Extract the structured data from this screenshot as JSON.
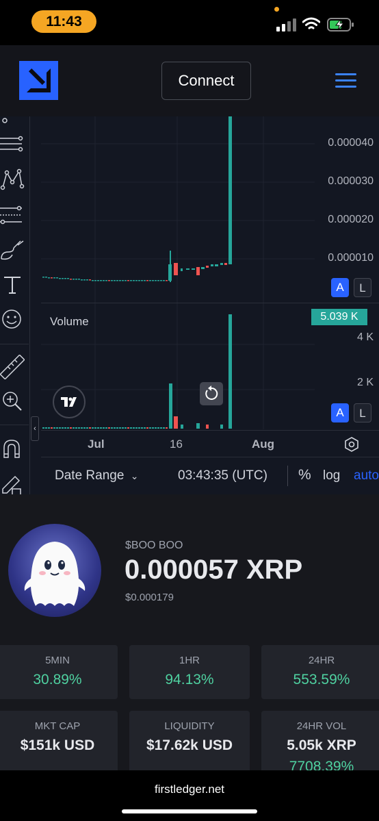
{
  "status_bar": {
    "time": "11:43"
  },
  "header": {
    "connect_label": "Connect"
  },
  "chart": {
    "price_axis": [
      "0.000040",
      "0.000030",
      "0.000020",
      "0.000010"
    ],
    "volume_title": "Volume",
    "volume_badge": "5.039 K",
    "volume_axis": [
      "4 K",
      "2 K"
    ],
    "auto_scale": "A",
    "log_scale": "L",
    "time_axis": {
      "month1": "Jul",
      "day": "16",
      "month2": "Aug"
    },
    "bottom": {
      "date_range": "Date Range",
      "clock": "03:43:35 (UTC)",
      "percent": "%",
      "log": "log",
      "auto": "auto"
    },
    "colors": {
      "up": "#26a69a",
      "down": "#ef5350",
      "accent": "#2962ff"
    }
  },
  "token": {
    "symbol_line": "$BOO BOO",
    "price": "0.000057 XRP",
    "price_usd": "$0.000179",
    "stats": [
      {
        "label": "5MIN",
        "value": "30.89%"
      },
      {
        "label": "1HR",
        "value": "94.13%"
      },
      {
        "label": "24HR",
        "value": "553.59%"
      }
    ],
    "metrics": [
      {
        "label": "MKT CAP",
        "value": "$151k USD"
      },
      {
        "label": "LIQUIDITY",
        "value": "$17.62k USD"
      },
      {
        "label": "24HR VOL",
        "value": "5.05k XRP",
        "extra": "7708.39%"
      }
    ]
  },
  "browser": {
    "url": "firstledger.net"
  }
}
